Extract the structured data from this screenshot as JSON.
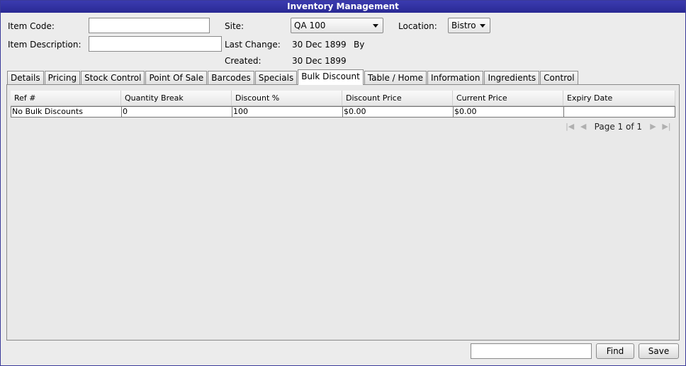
{
  "window": {
    "title": "Inventory Management"
  },
  "form": {
    "item_code_label": "Item Code:",
    "item_code_value": "",
    "item_description_label": "Item Description:",
    "item_description_value": "",
    "site_label": "Site:",
    "site_value": "QA 100",
    "location_label": "Location:",
    "location_value": "Bistro",
    "last_change_label": "Last Change:",
    "last_change_value": "30 Dec 1899",
    "by_label": "By",
    "created_label": "Created:",
    "created_value": "30 Dec 1899"
  },
  "tabs": [
    {
      "label": "Details"
    },
    {
      "label": "Pricing"
    },
    {
      "label": "Stock Control"
    },
    {
      "label": "Point Of Sale"
    },
    {
      "label": "Barcodes"
    },
    {
      "label": "Specials"
    },
    {
      "label": "Bulk Discount",
      "active": true
    },
    {
      "label": "Table / Home"
    },
    {
      "label": "Information"
    },
    {
      "label": "Ingredients"
    },
    {
      "label": "Control"
    }
  ],
  "grid": {
    "columns": [
      "Ref #",
      "Quantity Break",
      "Discount %",
      "Discount Price",
      "Current Price",
      "Expiry Date"
    ],
    "rows": [
      [
        "No Bulk Discounts",
        "0",
        "100",
        "$0.00",
        "$0.00",
        ""
      ]
    ]
  },
  "pager": {
    "text": "Page 1 of 1"
  },
  "footer": {
    "find_input_value": "",
    "find_label": "Find",
    "save_label": "Save"
  }
}
